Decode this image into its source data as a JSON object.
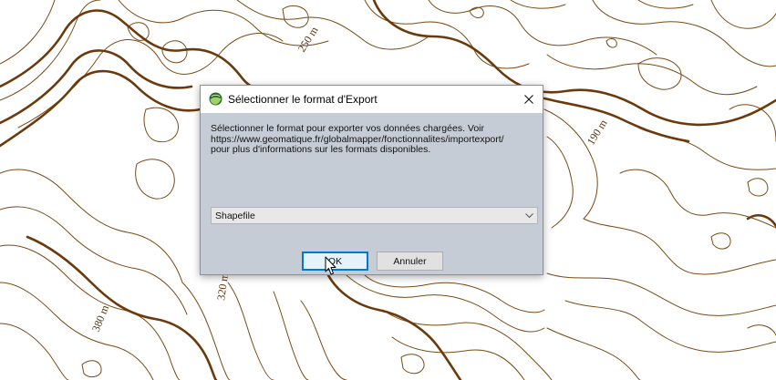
{
  "map": {
    "labels": {
      "label_250": "250 m",
      "label_190": "190 m",
      "label_320": "320 m",
      "label_380": "380 m"
    }
  },
  "dialog": {
    "title": "Sélectionner le format d'Export",
    "icon": "globalmapper-globe-icon",
    "info_lines": [
      "Sélectionner le format pour exporter vos données chargées. Voir",
      "https://www.geomatique.fr/globalmapper/fonctionnalites/importexport/",
      "pour plus d'informations sur les formats disponibles."
    ],
    "format_select": {
      "selected": "Shapefile"
    },
    "buttons": {
      "ok": "OK",
      "cancel": "Annuler"
    }
  },
  "colors": {
    "contour": "#7a4a14",
    "contour_index": "#6b3a0c",
    "dialog_body": "#c6ccd5",
    "focus_border": "#0078d7"
  }
}
